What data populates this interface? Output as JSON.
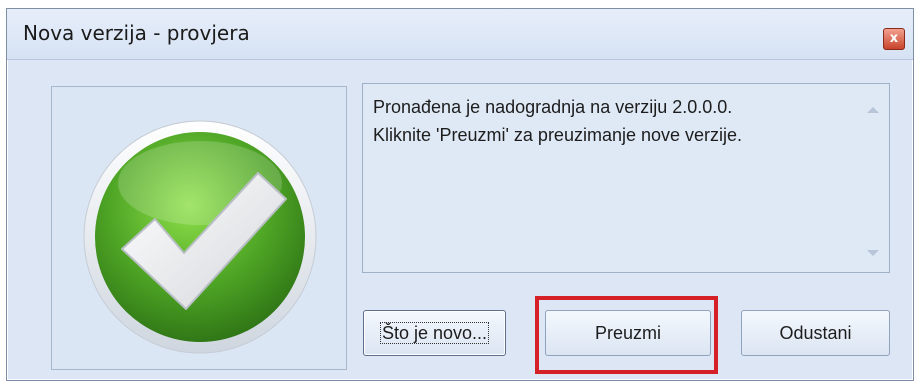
{
  "window": {
    "title": "Nova verzija - provjera",
    "close_label": "x"
  },
  "logo": {
    "icon": "checkmark-icon",
    "colors": {
      "green_dark": "#2f7d17",
      "green_light": "#7ccf3c",
      "check": "#f2f2f2"
    }
  },
  "message": {
    "text": "Pronađena je nadogradnja na verziju 2.0.0.0.\nKliknite 'Preuzmi' za preuzimanje nove verzije."
  },
  "buttons": {
    "whats_new": "Što je novo...",
    "download": "Preuzmi",
    "cancel": "Odustani"
  },
  "annotation": {
    "highlight_color": "#d52027"
  }
}
